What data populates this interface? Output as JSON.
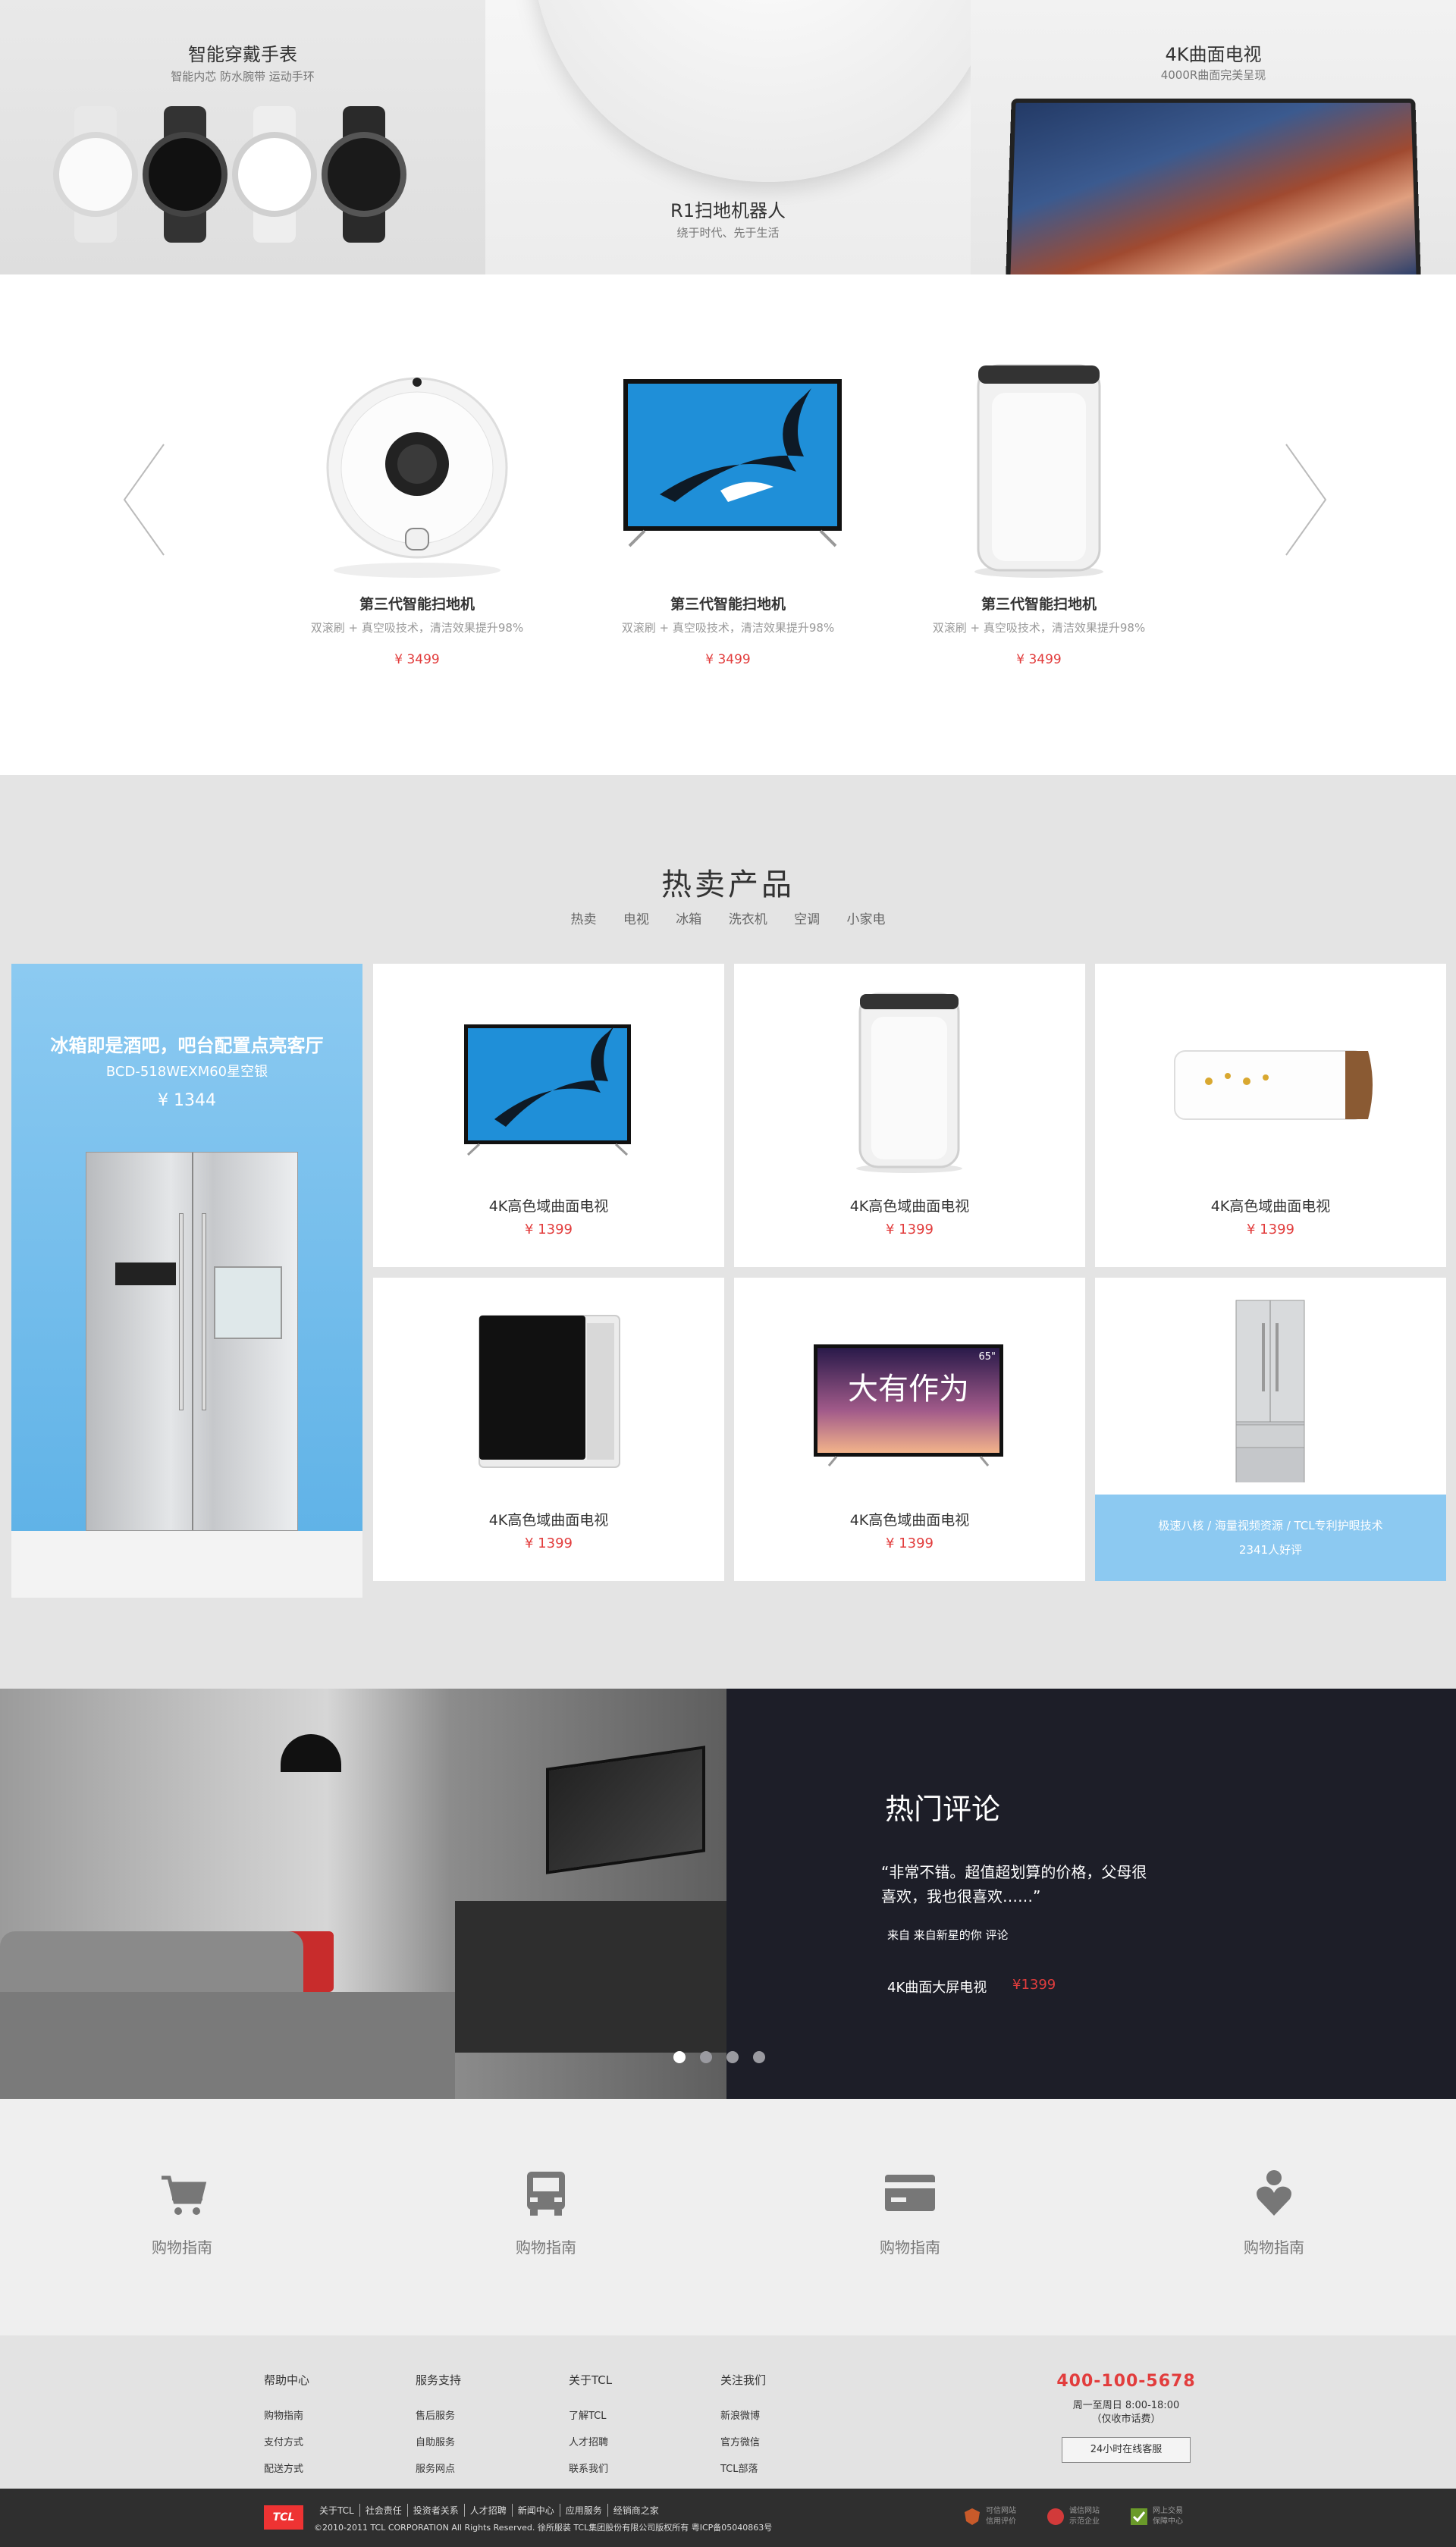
{
  "banners": [
    {
      "title": "智能穿戴手表",
      "subtitle": "智能内芯 防水腕带 运动手环"
    },
    {
      "title": "R1扫地机器人",
      "subtitle": "绕于时代、先于生活"
    },
    {
      "title": "4K曲面电视",
      "subtitle": "4000R曲面完美呈现"
    }
  ],
  "carousel": {
    "items": [
      {
        "name": "第三代智能扫地机",
        "desc": "双滚刷 + 真空吸技术，清洁效果提升98%",
        "price": "¥ 3499"
      },
      {
        "name": "第三代智能扫地机",
        "desc": "双滚刷 + 真空吸技术，清洁效果提升98%",
        "price": "¥ 3499"
      },
      {
        "name": "第三代智能扫地机",
        "desc": "双滚刷 + 真空吸技术，清洁效果提升98%",
        "price": "¥ 3499"
      }
    ]
  },
  "hot": {
    "title": "热卖产品",
    "tabs": [
      "热卖",
      "电视",
      "冰箱",
      "洗衣机",
      "空调",
      "小家电"
    ],
    "feature": {
      "title": "冰箱即是酒吧，吧台配置点亮客厅",
      "model": "BCD-518WEXM60星空银",
      "price": "¥ 1344"
    },
    "cells": [
      {
        "name": "4K高色域曲面电视",
        "price": "¥ 1399"
      },
      {
        "name": "4K高色域曲面电视",
        "price": "¥ 1399"
      },
      {
        "name": "4K高色域曲面电视",
        "price": "¥ 1399"
      },
      {
        "name": "4K高色域曲面电视",
        "price": "¥ 1399"
      },
      {
        "name": "4K高色域曲面电视",
        "price": "¥ 1399"
      }
    ],
    "promo": {
      "line1": "极速八核 / 海量视频资源 / TCL专利护眼技术",
      "line2": "2341人好评"
    },
    "tv_text": "大有作为",
    "tv_size": "65\""
  },
  "review": {
    "title": "热门评论",
    "quote": "“非常不错。超值超划算的价格，父母很喜欢，我也很喜欢……”",
    "source": "来自  来自新星的你  评论",
    "product": "4K曲面大屏电视",
    "price": "¥1399"
  },
  "services": [
    {
      "label": "购物指南",
      "icon": "cart-icon"
    },
    {
      "label": "购物指南",
      "icon": "truck-icon"
    },
    {
      "label": "购物指南",
      "icon": "card-icon"
    },
    {
      "label": "购物指南",
      "icon": "user-heart-icon"
    }
  ],
  "footer": {
    "columns": [
      {
        "title": "帮助中心",
        "links": [
          "购物指南",
          "支付方式",
          "配送方式"
        ]
      },
      {
        "title": "服务支持",
        "links": [
          "售后服务",
          "自助服务",
          "服务网点"
        ]
      },
      {
        "title": "关于TCL",
        "links": [
          "了解TCL",
          "人才招聘",
          "联系我们"
        ]
      },
      {
        "title": "关注我们",
        "links": [
          "新浪微博",
          "官方微信",
          "TCL部落"
        ]
      }
    ],
    "phone": "400-100-5678",
    "hours": "周一至周日 8:00-18:00",
    "hours_note": "（仅收市话费）",
    "online_button": "24小时在线客服"
  },
  "bottom": {
    "logo": "TCL",
    "links": [
      "关于TCL",
      "社会责任",
      "投资者关系",
      "人才招聘",
      "新闻中心",
      "应用服务",
      "经销商之家"
    ],
    "copyright": "©2010-2011 TCL CORPORATION All Rights Reserved.  徐所服装   TCL集团股份有限公司版权所有  粤ICP备05040863号",
    "badges": [
      {
        "l1": "可信网站",
        "l2": "信用评价"
      },
      {
        "l1": "诚信网站",
        "l2": "示范企业"
      },
      {
        "l1": "网上交易",
        "l2": "保障中心"
      }
    ]
  },
  "colors": {
    "accent_red": "#e23d3d",
    "feature_blue": "#8cc9f1",
    "review_bg": "#1d1e28"
  }
}
